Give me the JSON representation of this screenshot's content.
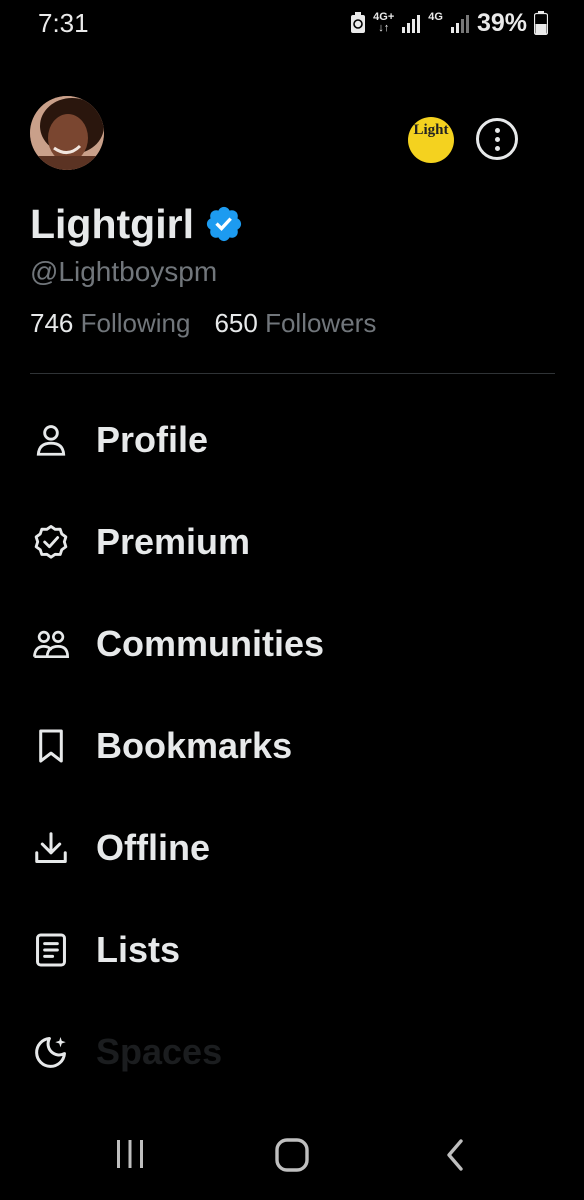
{
  "status_bar": {
    "time": "7:31",
    "network1": "4G+",
    "network2": "4G",
    "battery": "39%"
  },
  "header": {
    "display_name": "Lightgirl",
    "handle": "@Lightboyspm",
    "following_count": "746",
    "following_label": "Following",
    "followers_count": "650",
    "followers_label": "Followers",
    "alt_account_text": "Light",
    "verified_color": "#1d9bf0"
  },
  "menu": {
    "items": [
      {
        "label": "Profile",
        "icon": "person-icon"
      },
      {
        "label": "Premium",
        "icon": "verified-badge-icon"
      },
      {
        "label": "Communities",
        "icon": "people-icon"
      },
      {
        "label": "Bookmarks",
        "icon": "bookmark-icon"
      },
      {
        "label": "Offline",
        "icon": "download-icon"
      },
      {
        "label": "Lists",
        "icon": "list-icon"
      },
      {
        "label": "Spaces",
        "icon": "moon-sparkle-icon"
      }
    ]
  },
  "nav": {
    "icons": [
      "recents-icon",
      "home-icon",
      "back-icon"
    ]
  }
}
